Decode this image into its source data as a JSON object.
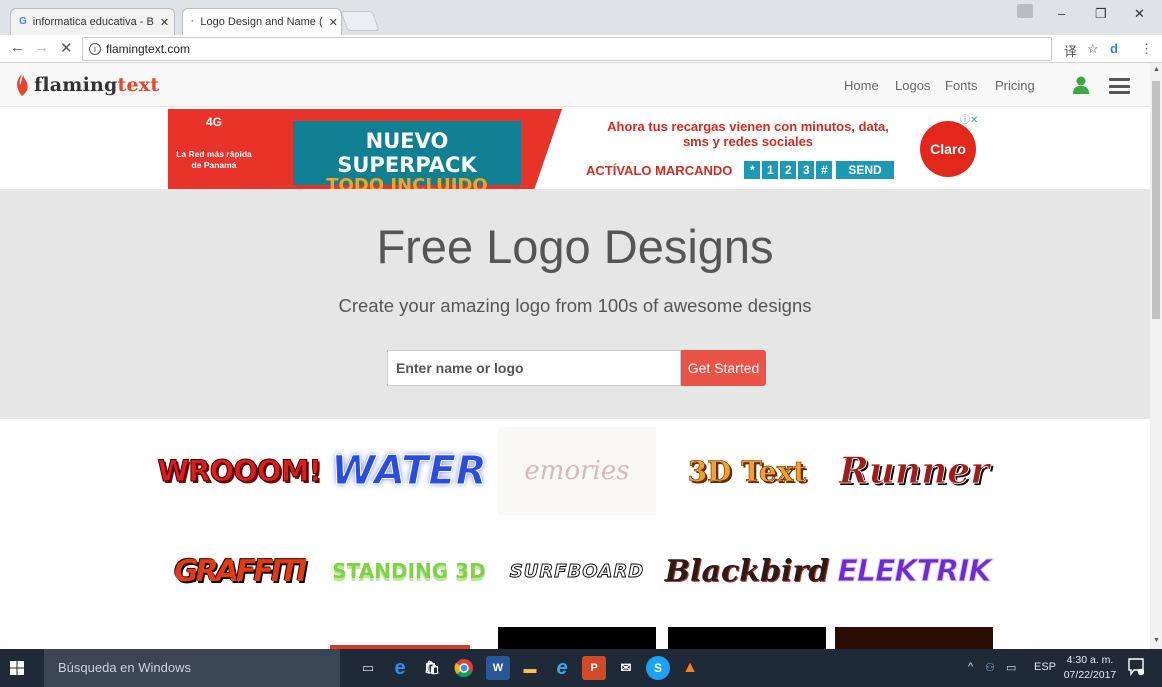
{
  "browser": {
    "tabs": [
      {
        "title": "informatica educativa - B",
        "favicon": "G"
      },
      {
        "title": "Logo Design and Name (",
        "favicon": ""
      }
    ],
    "url": "flamingtext.com",
    "window_controls": {
      "minimize": "–",
      "restore": "❐",
      "close": "✕"
    }
  },
  "site": {
    "logo": {
      "part1": "flaming",
      "part2": "text"
    },
    "nav": {
      "home": "Home",
      "logos": "Logos",
      "fonts": "Fonts",
      "pricing": "Pricing"
    },
    "brand_color": "#ea5447"
  },
  "ad": {
    "badge": "4G",
    "left_text": "La Red más rápida de Panamá",
    "headline": "NUEVO SUPERPACK",
    "subheadline": "TODO INCLUIDO",
    "message": "Ahora tus recargas vienen con minutos, data, sms y redes sociales",
    "cta_prefix": "ACTÍVALO MARCANDO",
    "keys": [
      "*",
      "1",
      "2",
      "3",
      "#"
    ],
    "send": "SEND",
    "brand": "Claro"
  },
  "hero": {
    "title": "Free Logo Designs",
    "subtitle": "Create your amazing logo from 100s of awesome designs",
    "search_placeholder": "Enter name or logo",
    "button": "Get Started"
  },
  "gallery": {
    "row1": [
      "WROOOM!",
      "WATER",
      "emories",
      "3D Text",
      "Runner"
    ],
    "row2": [
      "GRAFFITI",
      "STANDING 3D",
      "SURFBOARD",
      "Blackbird",
      "ELEKTRIK"
    ]
  },
  "taskbar": {
    "search": "Búsqueda en Windows",
    "language": "ESP",
    "time": "4:30 a. m.",
    "date": "07/22/2017"
  }
}
